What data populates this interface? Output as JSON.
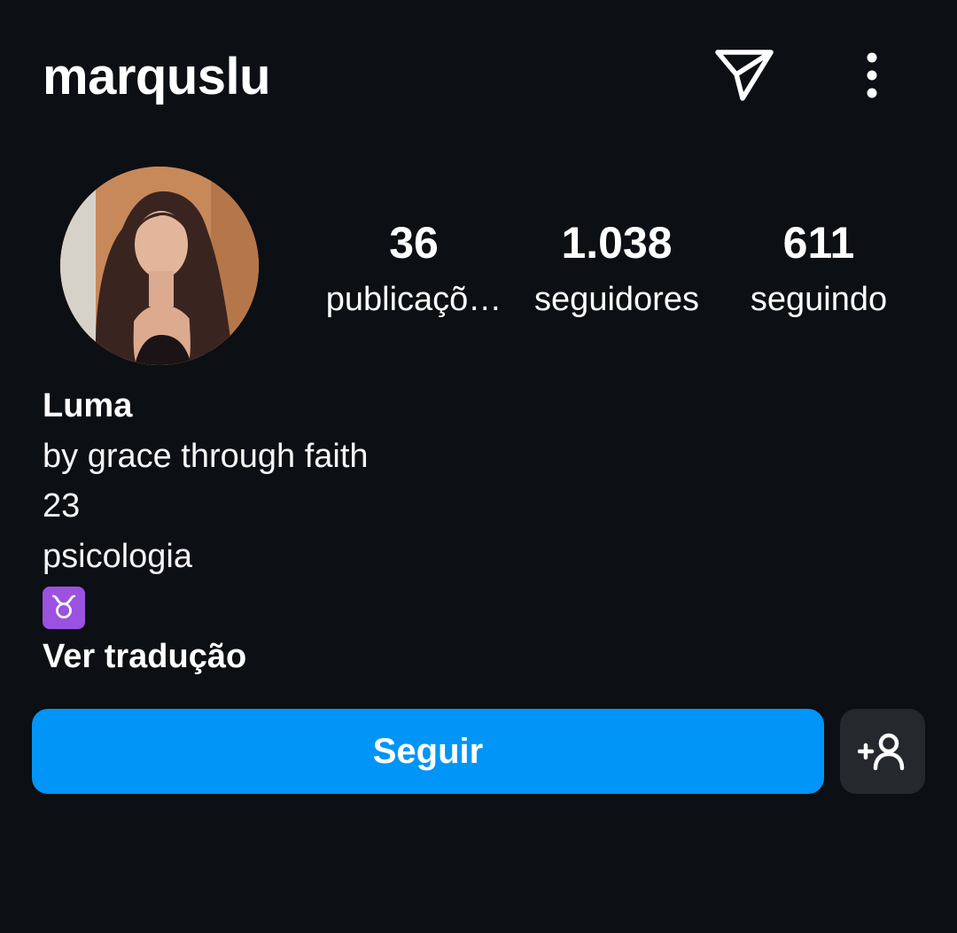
{
  "header": {
    "username": "marquslu",
    "icons": [
      "send-icon",
      "more-vertical-icon"
    ]
  },
  "profile": {
    "avatar_icon": "profile-photo",
    "stats": {
      "posts": {
        "value": "36",
        "label": "publicaçõ…"
      },
      "followers": {
        "value": "1.038",
        "label": "seguidores"
      },
      "following": {
        "value": "611",
        "label": "seguindo"
      }
    }
  },
  "bio": {
    "name": "Luma",
    "lines": [
      "by grace through faith",
      "23",
      "psicologia"
    ],
    "emoji": "♉",
    "translate_link": "Ver tradução"
  },
  "actions": {
    "follow_label": "Seguir",
    "suggest_icon": "add-person-icon"
  },
  "colors": {
    "background": "#0c0f14",
    "accent": "#0095f6",
    "secondary_button": "#25282d",
    "zodiac_badge": "#9c52e0"
  }
}
